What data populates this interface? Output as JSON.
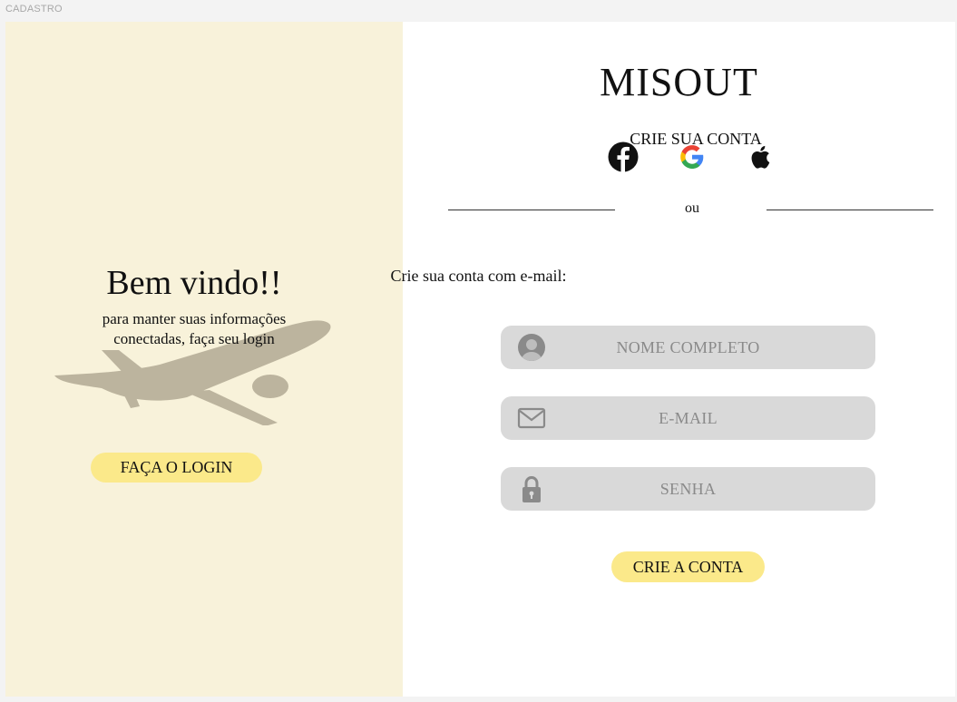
{
  "frame": {
    "label": "CADASTRO"
  },
  "left": {
    "title": "Bem vindo!!",
    "subtitle_lines": [
      "para manter suas informações",
      "conectadas, faça seu login"
    ],
    "login_button": "FAÇA O LOGIN",
    "illustration": "airplane-silhouette"
  },
  "right": {
    "brand": "MISOUT",
    "create_title": "CRIE SUA CONTA",
    "social": [
      {
        "name": "facebook-icon"
      },
      {
        "name": "google-icon"
      },
      {
        "name": "apple-icon"
      }
    ],
    "divider_text": "ou",
    "email_label": "Crie sua conta com e-mail:",
    "fields": [
      {
        "placeholder": "NOME COMPLETO",
        "icon": "user-icon"
      },
      {
        "placeholder": "E-MAIL",
        "icon": "mail-icon"
      },
      {
        "placeholder": "SENHA",
        "icon": "lock-icon"
      }
    ],
    "create_button": "CRIE A CONTA"
  },
  "colors": {
    "left_background": "#f8f2da",
    "button_yellow": "#fbe98a",
    "field_gray": "#d9d9d9",
    "placeholder_gray": "#8a8a8a",
    "airplane": "#bcb49e"
  }
}
